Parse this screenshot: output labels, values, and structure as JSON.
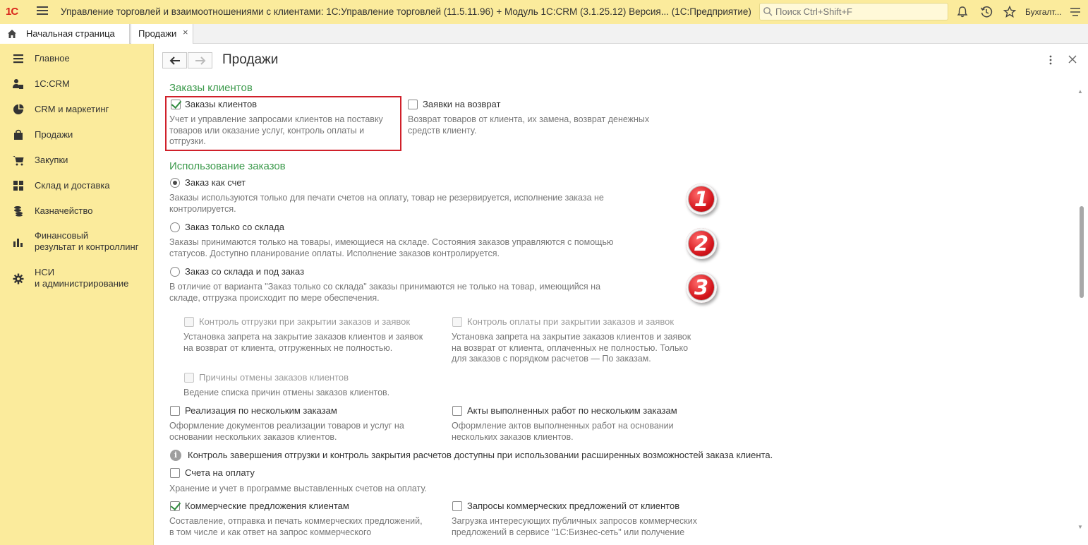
{
  "titlebar": {
    "logo": "1С",
    "app_title": "Управление торговлей и взаимоотношениями с клиентами: 1С:Управление торговлей (11.5.11.96) + Модуль 1С:CRM (3.1.25.12) Версия...  (1С:Предприятие)",
    "search_placeholder": "Поиск Ctrl+Shift+F",
    "user": "Бухгалт..."
  },
  "tabs": [
    {
      "label": "Начальная страница"
    },
    {
      "label": "Продажи",
      "close": "×"
    }
  ],
  "sidebar": {
    "items": [
      {
        "label": "Главное",
        "icon": "hamburger-icon"
      },
      {
        "label": "1С:CRM",
        "icon": "users-icon"
      },
      {
        "label": "CRM и маркетинг",
        "icon": "pie-chart-icon"
      },
      {
        "label": "Продажи",
        "icon": "bag-icon"
      },
      {
        "label": "Закупки",
        "icon": "cart-icon"
      },
      {
        "label": "Склад и доставка",
        "icon": "grid-icon"
      },
      {
        "label": "Казначейство",
        "icon": "coins-icon"
      },
      {
        "label": "Финансовый\nрезультат и контроллинг",
        "icon": "bar-chart-icon"
      },
      {
        "label": "НСИ\nи администрирование",
        "icon": "gear-icon"
      }
    ]
  },
  "page": {
    "title": "Продажи",
    "sections": {
      "customer_orders": "Заказы клиентов",
      "order_usage": "Использование заказов"
    },
    "customer_orders": {
      "label": "Заказы клиентов",
      "checked": true,
      "description": "Учет и управление запросами клиентов на поставку\nтоваров или оказание услуг, контроль оплаты и\nотгрузки."
    },
    "returns": {
      "label": "Заявки на возврат",
      "checked": false,
      "description": "Возврат товаров от клиента, их замена, возврат денежных\nсредств клиенту."
    },
    "order_modes": [
      {
        "label": "Заказ как счет",
        "selected": true,
        "description": "Заказы используются только для печати счетов на оплату, товар не резервируется, исполнение заказа не\nконтролируется.",
        "badge": "1"
      },
      {
        "label": "Заказ только со склада",
        "selected": false,
        "description": "Заказы принимаются только на товары, имеющиеся на складе. Состояния заказов управляются с помощью\nстатусов. Доступно планирование оплаты. Исполнение заказов контролируется.",
        "badge": "2"
      },
      {
        "label": "Заказ со склада и под заказ",
        "selected": false,
        "description": "В отличие от варианта \"Заказ только со склада\" заказы принимаются не только на товар, имеющийся на\nскладе, отгрузка происходит по мере обеспечения.",
        "badge": "3"
      }
    ],
    "shipment_control": {
      "label": "Контроль отгрузки при закрытии заказов и заявок",
      "description": "Установка запрета на закрытие заказов клиентов и заявок\nна возврат от клиента, отгруженных не полностью."
    },
    "payment_control": {
      "label": "Контроль оплаты при закрытии заказов и заявок",
      "description": "Установка запрета на закрытие заказов клиентов и заявок\nна возврат от клиента, оплаченных не полностью. Только\nдля заказов с порядком расчетов — По заказам."
    },
    "cancel_reasons": {
      "label": "Причины отмены заказов клиентов",
      "description": "Ведение списка причин отмены заказов клиентов."
    },
    "multi_orders_sales": {
      "label": "Реализация по нескольким заказам",
      "description": "Оформление документов реализации товаров и услуг на\nосновании нескольких заказов клиентов."
    },
    "multi_orders_acts": {
      "label": "Акты выполненных работ по нескольким заказам",
      "description": "Оформление актов выполненных работ на основании\nнескольких заказов клиентов."
    },
    "info_text": "Контроль завершения отгрузки и контроль закрытия расчетов доступны при использовании расширенных возможностей заказа клиента.",
    "invoices": {
      "label": "Счета на оплату",
      "description": "Хранение и учет в программе выставленных счетов на оплату."
    },
    "commercial_offers": {
      "label": "Коммерческие предложения клиентам",
      "checked": true,
      "description": "Составление, отправка и печать коммерческих предложений,\nв том числе и как ответ на запрос коммерческого"
    },
    "offer_requests": {
      "label": "Запросы коммерческих предложений от клиентов",
      "description": "Загрузка интересующих публичных запросов коммерческих\nпредложений в сервисе \"1С:Бизнес-сеть\" или получение"
    }
  },
  "colors": {
    "accent_yellow": "#fbeb9c",
    "section_green": "#3c9a4c",
    "highlight_red": "#d0202a",
    "badge_red": "#d3141b"
  }
}
